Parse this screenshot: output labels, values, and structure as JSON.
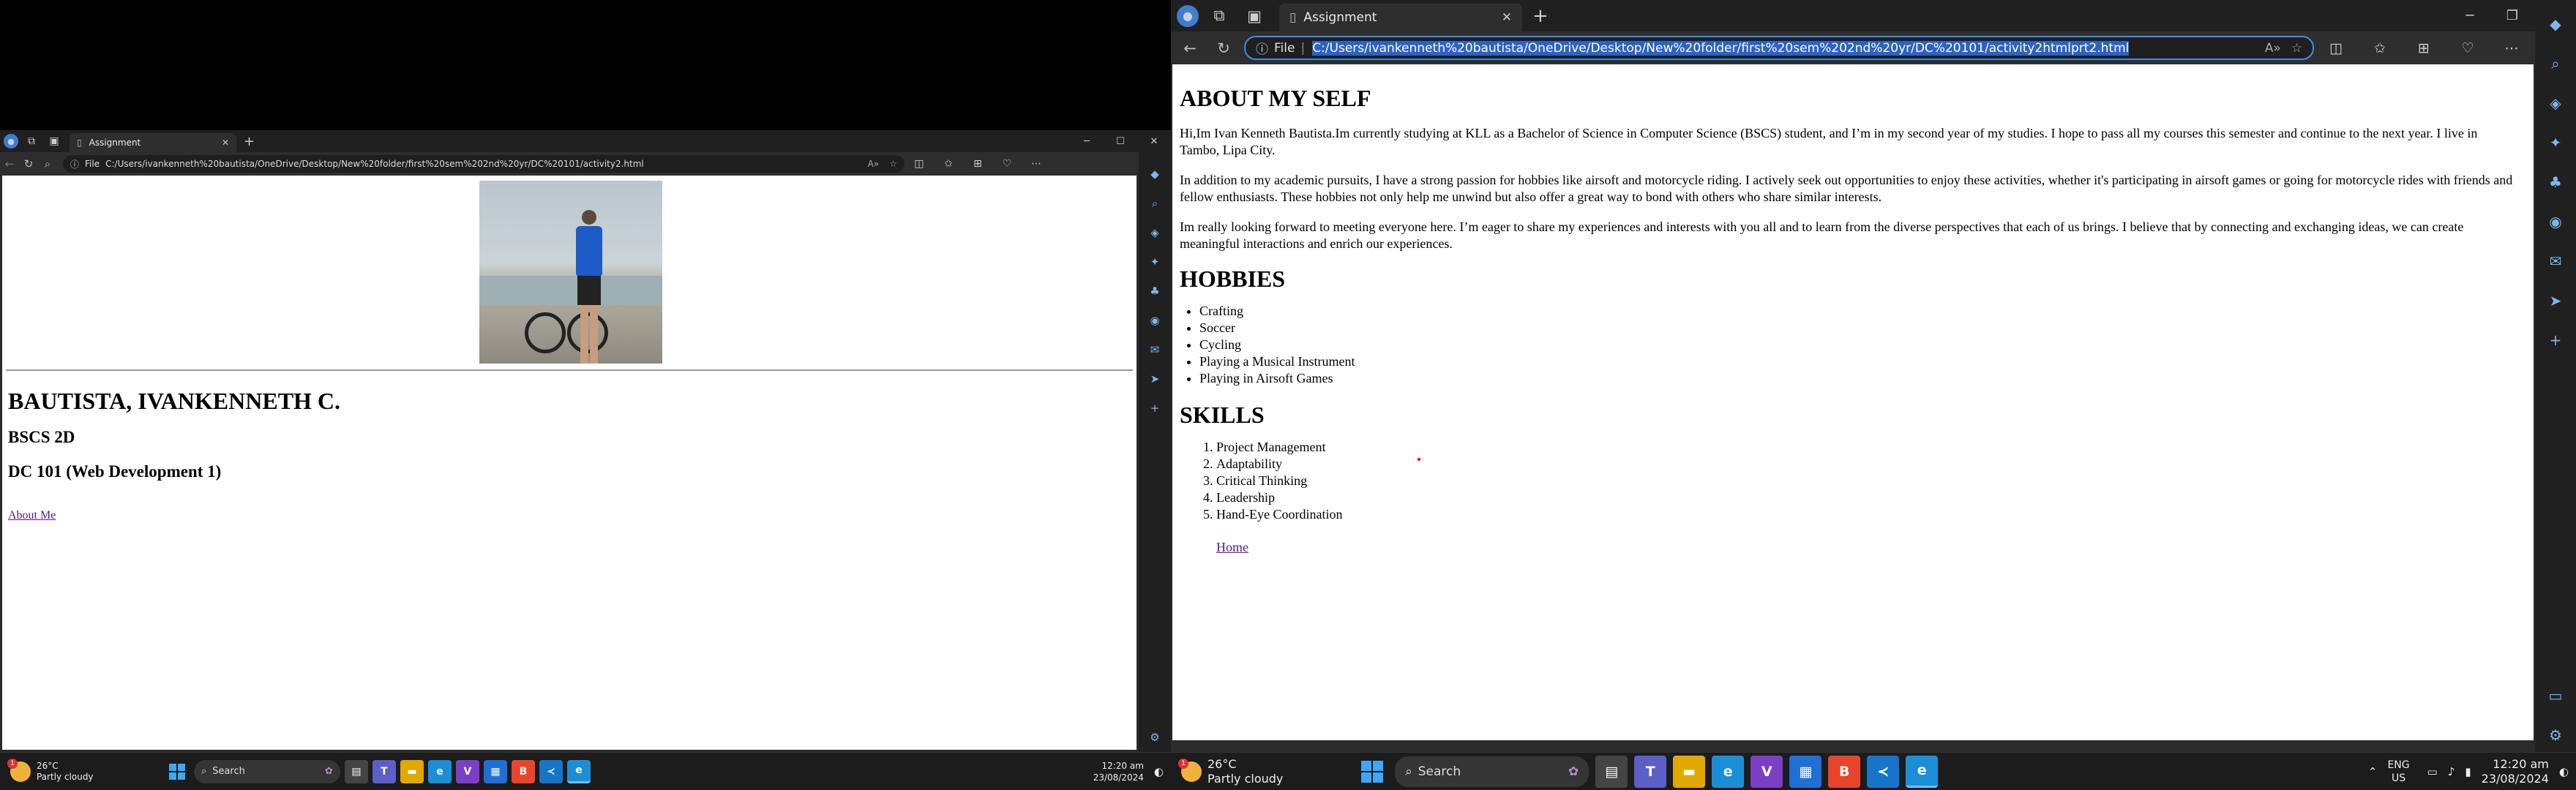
{
  "left_window": {
    "tab_title": "Assignment",
    "url": "C:/Users/ivankenneth%20bautista/OneDrive/Desktop/New%20folder/first%20sem%202nd%20yr/DC%20101/activity2.html",
    "url_prefix": "File",
    "page": {
      "name": "BAUTISTA, IVANKENNETH C.",
      "section": "BSCS 2D",
      "course": "DC 101 (Web Development 1)",
      "link": "About Me"
    }
  },
  "right_window": {
    "tab_title": "Assignment",
    "url": "C:/Users/ivankenneth%20bautista/OneDrive/Desktop/New%20folder/first%20sem%202nd%20yr/DC%20101/activity2htmlprt2.html",
    "url_prefix": "File",
    "page": {
      "about_heading": "ABOUT MY SELF",
      "paragraphs": [
        "Hi,Im Ivan Kenneth Bautista.Im currently studying at KLL as a Bachelor of Science in Computer Science (BSCS) student, and I’m in my second year of my studies. I hope to pass all my courses this semester and continue to the next year. I live in Tambo, Lipa City.",
        "In addition to my academic pursuits, I have a strong passion for hobbies like airsoft and motorcycle riding. I actively seek out opportunities to enjoy these activities, whether it's participating in airsoft games or going for motorcycle rides with friends and fellow enthusiasts. These hobbies not only help me unwind but also offer a great way to bond with others who share similar interests.",
        "Im really looking forward to meeting everyone here. I’m eager to share my experiences and interests with you all and to learn from the diverse perspectives that each of us brings. I believe that by connecting and exchanging ideas, we can create meaningful interactions and enrich our experiences."
      ],
      "hobbies_heading": "HOBBIES",
      "hobbies": [
        "Crafting",
        "Soccer",
        "Cycling",
        "Playing a Musical Instrument",
        "Playing in Airsoft Games"
      ],
      "skills_heading": "SKILLS",
      "skills": [
        "Project Management",
        "Adaptability",
        "Critical Thinking",
        "Leadership",
        "Hand-Eye Coordination"
      ],
      "home_link": "Home"
    }
  },
  "taskbar": {
    "weather_temp": "26°C",
    "weather_desc": "Partly cloudy",
    "weather_badge": "1",
    "search_label": "Search",
    "time": "12:20 am",
    "date": "23/08/2024",
    "lang_1": "ENG",
    "lang_2": "US"
  },
  "colors": {
    "accent": "#3e8ee8",
    "visited_link": "#551a8b",
    "url_selection": "#2d62c4"
  }
}
